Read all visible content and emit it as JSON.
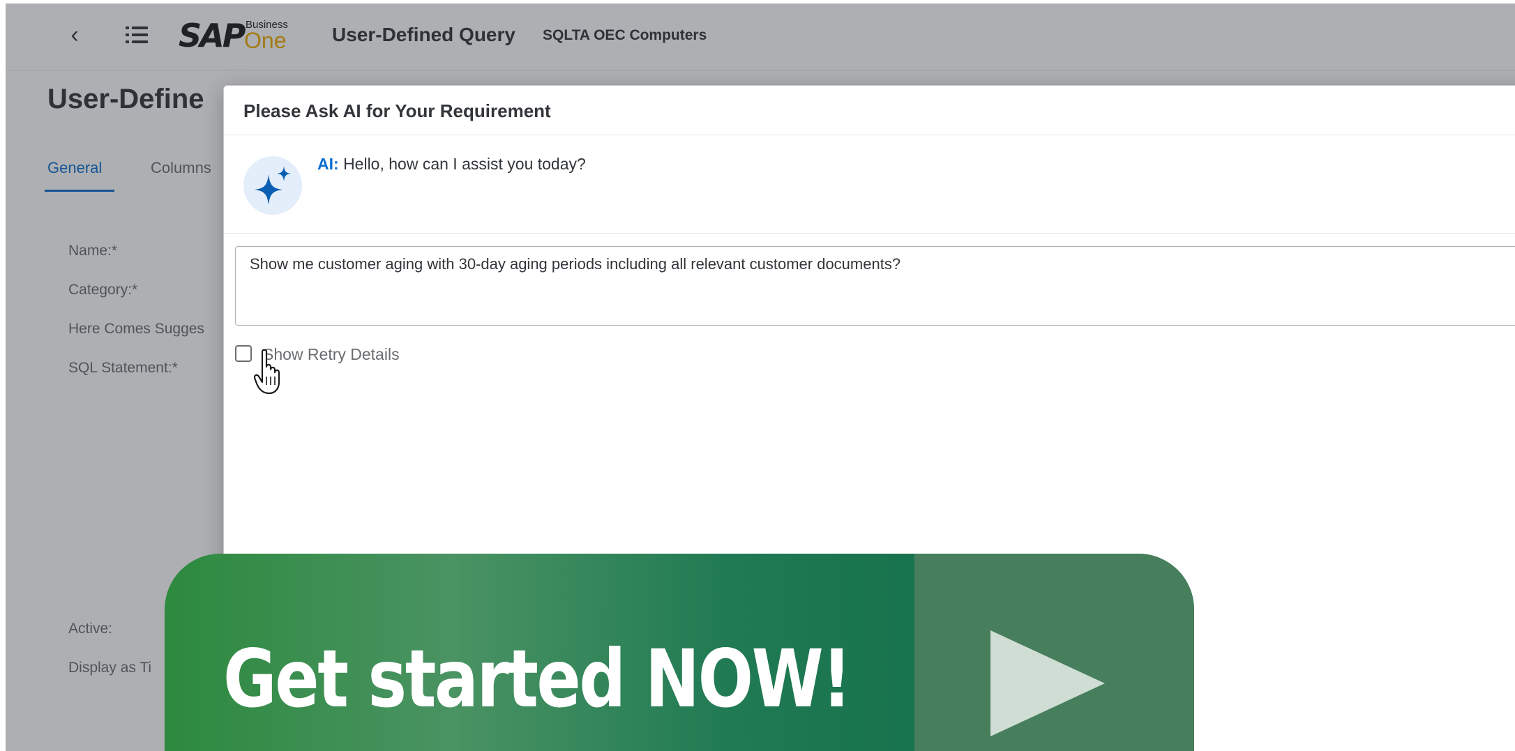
{
  "shell": {
    "back_icon": "chevron-left-icon",
    "menu_icon": "list-icon",
    "logo_brand": "SAP",
    "logo_business": "Business",
    "logo_one": "One",
    "app_title": "User-Defined Query",
    "company": "SQLTA OEC Computers"
  },
  "background_page": {
    "title": "User-Define",
    "tabs": [
      "General",
      "Columns"
    ],
    "fields": [
      "Name:*",
      "Category:*",
      "Here Comes Sugges",
      "SQL Statement:*",
      "Active:",
      "Display as Ti"
    ]
  },
  "dialog": {
    "title": "Please Ask AI for Your Requirement",
    "ai_icon": "sparkle-icon",
    "ai_name": "AI:",
    "ai_message": "Hello, how can I assist you today?",
    "prompt_text": "Show me customer aging with 30-day aging periods including all relevant customer documents?",
    "retry_label": "Show Retry Details",
    "retry_checked": false
  },
  "cta": {
    "text": "Get started NOW!",
    "play_icon": "play-icon"
  },
  "colors": {
    "accent": "#0a6ed1",
    "brand_orange": "#f0ab00",
    "cta_green": "#207a53"
  }
}
